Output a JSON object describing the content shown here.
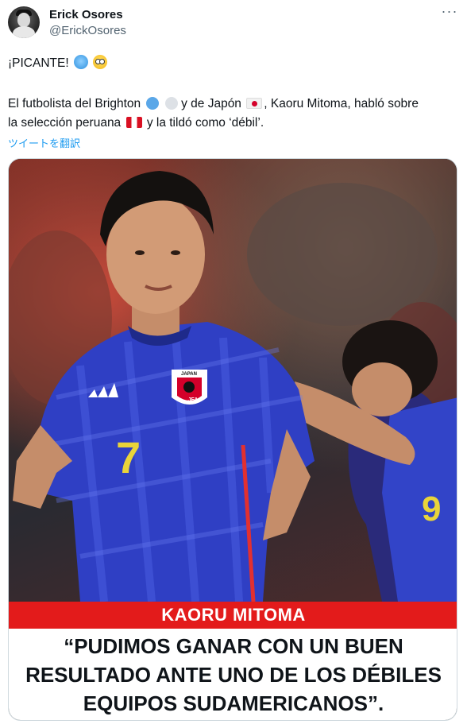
{
  "author": {
    "display_name": "Erick Osores",
    "handle": "@ErickOsores",
    "avatar_icon": "profile-photo"
  },
  "more_icon": "ellipsis-icon",
  "more_glyph": "···",
  "tweet": {
    "line1_text": "¡PICANTE!",
    "line1_emojis": [
      "cold-face-emoji",
      "flushed-face-emoji"
    ],
    "line2_part1": "El futbolista del Brighton",
    "line2_emojis": [
      "blue-circle-emoji",
      "white-circle-emoji"
    ],
    "line2_part2": "y de Japón",
    "line2_flag": "japan-flag-emoji",
    "line2_part3": ", Kaoru Mitoma, habló sobre",
    "line3_part1": "la selección peruana",
    "line3_flag": "peru-flag-emoji",
    "line3_part2": "y la tildó como ‘débil’.",
    "translate_link": "ツイートを翻訳"
  },
  "image": {
    "headline_name": "KAORU MITOMA",
    "quote_line1": "“PUDIMOS GANAR CON UN BUEN",
    "quote_line2": "RESULTADO ANTE UNO DE LOS DÉBILES",
    "quote_line3": "EQUIPOS SUDAMERICANOS”.",
    "jersey_number_main": "7",
    "jersey_number_second": "9",
    "crest_text": "JAPAN",
    "crest_sub": "JFA"
  },
  "colors": {
    "link_blue": "#1d9bf0",
    "name_bar_red": "#e31b1b",
    "jersey_blue": "#2f3fc4",
    "number_yellow": "#e9d43a"
  }
}
